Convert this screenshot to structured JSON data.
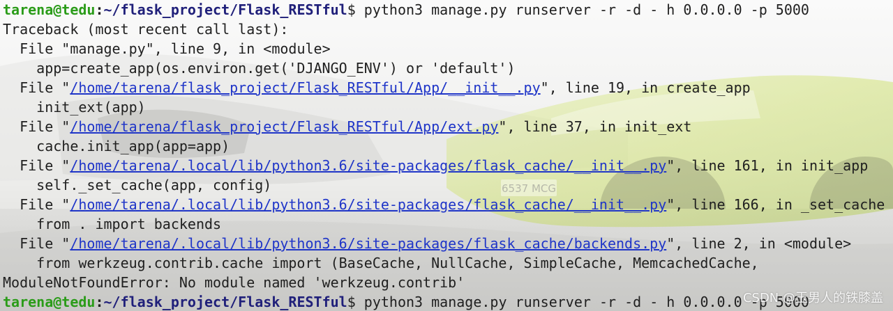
{
  "window": {
    "bg_color": "#f3f3f2",
    "accent_green": "#2b9c19",
    "path_blue": "#20207a",
    "link_blue": "#1f35c8"
  },
  "background": {
    "image_name": "sports-car-wallpaper",
    "plate_text": "6537 MCG"
  },
  "prompt": {
    "user_host": "tarena@tedu",
    "separator": ":",
    "path": "~/flask_project/Flask_RESTful",
    "dollar": "$ "
  },
  "terminal": {
    "command_1": "python3 manage.py runserver -r -d - h 0.0.0.0 -p 5000",
    "traceback_header": "Traceback (most recent call last):",
    "frames": [
      {
        "prefix": "  File \"",
        "file": "manage.py",
        "is_link": false,
        "suffix": "\", line 9, in <module>",
        "code": "    app=create_app(os.environ.get('DJANGO_ENV') or 'default')"
      },
      {
        "prefix": "  File \"",
        "file": "/home/tarena/flask_project/Flask_RESTful/App/__init__.py",
        "is_link": true,
        "suffix": "\", line 19, in create_app",
        "code": "    init_ext(app)"
      },
      {
        "prefix": "  File \"",
        "file": "/home/tarena/flask_project/Flask_RESTful/App/ext.py",
        "is_link": true,
        "suffix": "\", line 37, in init_ext",
        "code": "    cache.init_app(app=app)"
      },
      {
        "prefix": "  File \"",
        "file": "/home/tarena/.local/lib/python3.6/site-packages/flask_cache/__init__.py",
        "is_link": true,
        "suffix": "\", line 161, in init_app",
        "code": "    self._set_cache(app, config)"
      },
      {
        "prefix": "  File \"",
        "file": "/home/tarena/.local/lib/python3.6/site-packages/flask_cache/__init__.py",
        "is_link": true,
        "suffix": "\", line 166, in _set_cache",
        "code": "    from . import backends"
      },
      {
        "prefix": "  File \"",
        "file": "/home/tarena/.local/lib/python3.6/site-packages/flask_cache/backends.py",
        "is_link": true,
        "suffix": "\", line 2, in <module>",
        "code": "    from werkzeug.contrib.cache import (BaseCache, NullCache, SimpleCache, MemcachedCache,"
      }
    ],
    "error": "ModuleNotFoundError: No module named 'werkzeug.contrib'",
    "command_2": "python3 manage.py runserver -r -d - h 0.0.0.0 -p 5000"
  },
  "watermark": {
    "text": "CSDN @玉男人的铁膝盖"
  }
}
